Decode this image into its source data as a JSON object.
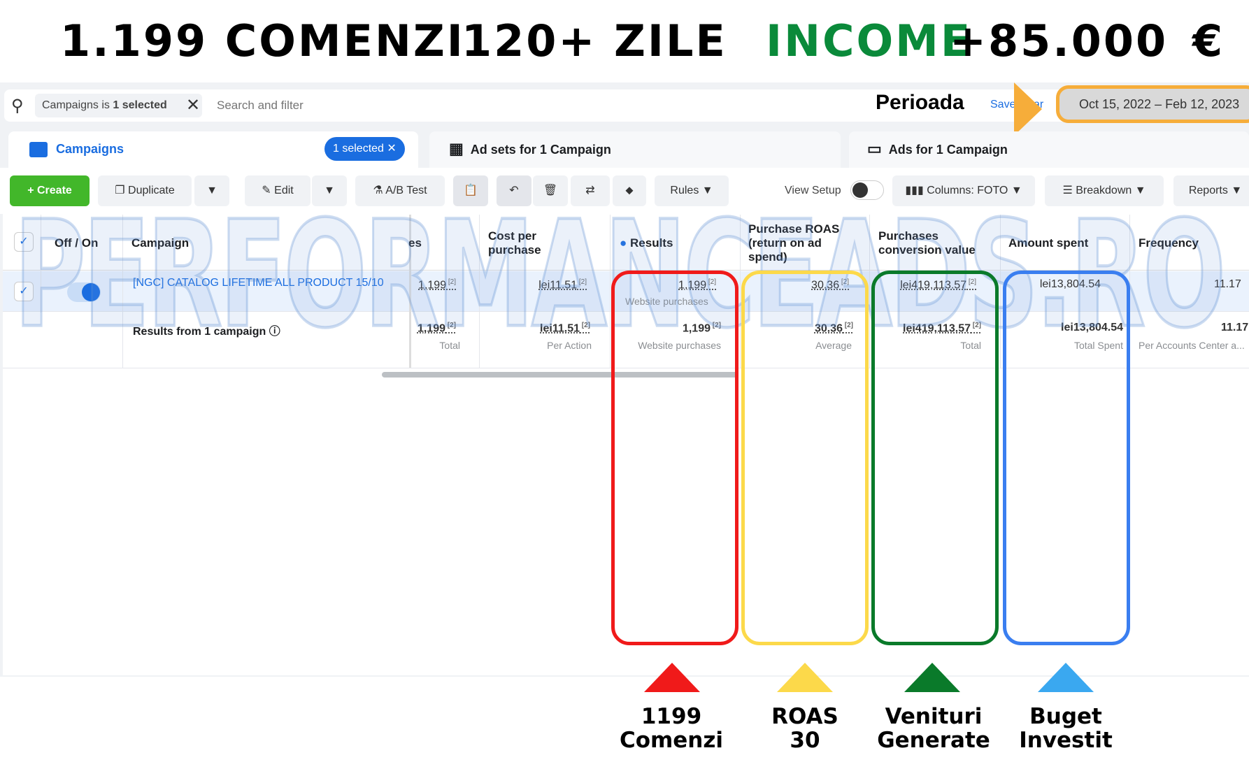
{
  "headline": {
    "orders": "1.199 COMENZI",
    "days": "120+ ZILE",
    "income_word": "INCOME",
    "income_value": "+85.000",
    "currency": "€",
    "income_color": "#0a8a3a"
  },
  "search": {
    "chip_prefix": "Campaigns is",
    "chip_value": "1 selected",
    "placeholder": "Search and filter",
    "period_label": "Perioada",
    "save": "Save",
    "clear": "ar",
    "date_range": "Oct 15, 2022 – Feb 12, 2023"
  },
  "tabs": {
    "campaigns": "Campaigns",
    "selected": "1 selected",
    "adsets": "Ad sets for 1 Campaign",
    "ads": "Ads for 1 Campaign"
  },
  "toolbar": {
    "create": "Create",
    "duplicate": "Duplicate",
    "edit": "Edit",
    "ab_test": "A/B Test",
    "rules": "Rules",
    "view_setup": "View Setup",
    "columns": "Columns: FOTO",
    "breakdown": "Breakdown",
    "reports": "Reports"
  },
  "watermark": "PERFORMANCEADS.RO",
  "table": {
    "headers": {
      "offon": "Off / On",
      "campaign": "Campaign",
      "purchases_trunc": "es",
      "cost": "Cost per purchase",
      "results": "Results",
      "roas": "Purchase ROAS (return on ad spend)",
      "conv_value": "Purchases conversion value",
      "spent": "Amount spent",
      "frequency": "Frequency"
    },
    "row": {
      "name": "[NGC] CATALOG LIFETIME ALL PRODUCT 15/10",
      "purchases": "1,199",
      "cost": "lei11.51",
      "results": "1,199",
      "results_sub": "Website purchases",
      "roas": "30.36",
      "conv_value": "lei419,113.57",
      "spent": "lei13,804.54",
      "frequency": "11.17"
    },
    "summary": {
      "label": "Results from 1 campaign",
      "purchases": "1,199",
      "purchases_sub": "Total",
      "cost": "lei11.51",
      "cost_sub": "Per Action",
      "results": "1,199",
      "results_sub": "Website purchases",
      "roas": "30.36",
      "roas_sub": "Average",
      "conv_value": "lei419,113.57",
      "conv_sub": "Total",
      "spent": "lei13,804.54",
      "spent_sub": "Total Spent",
      "frequency": "11.17",
      "frequency_sub": "Per Accounts Center a..."
    },
    "footnote": "[2]"
  },
  "annotations": [
    {
      "line1": "1199",
      "line2": "Comenzi",
      "color": "#f01a1a"
    },
    {
      "line1": "ROAS",
      "line2": "30",
      "color": "#fcd94a"
    },
    {
      "line1": "Venituri",
      "line2": "Generate",
      "color": "#0a7a2a"
    },
    {
      "line1": "Buget",
      "line2": "Investit",
      "color": "#3a86f0"
    }
  ]
}
